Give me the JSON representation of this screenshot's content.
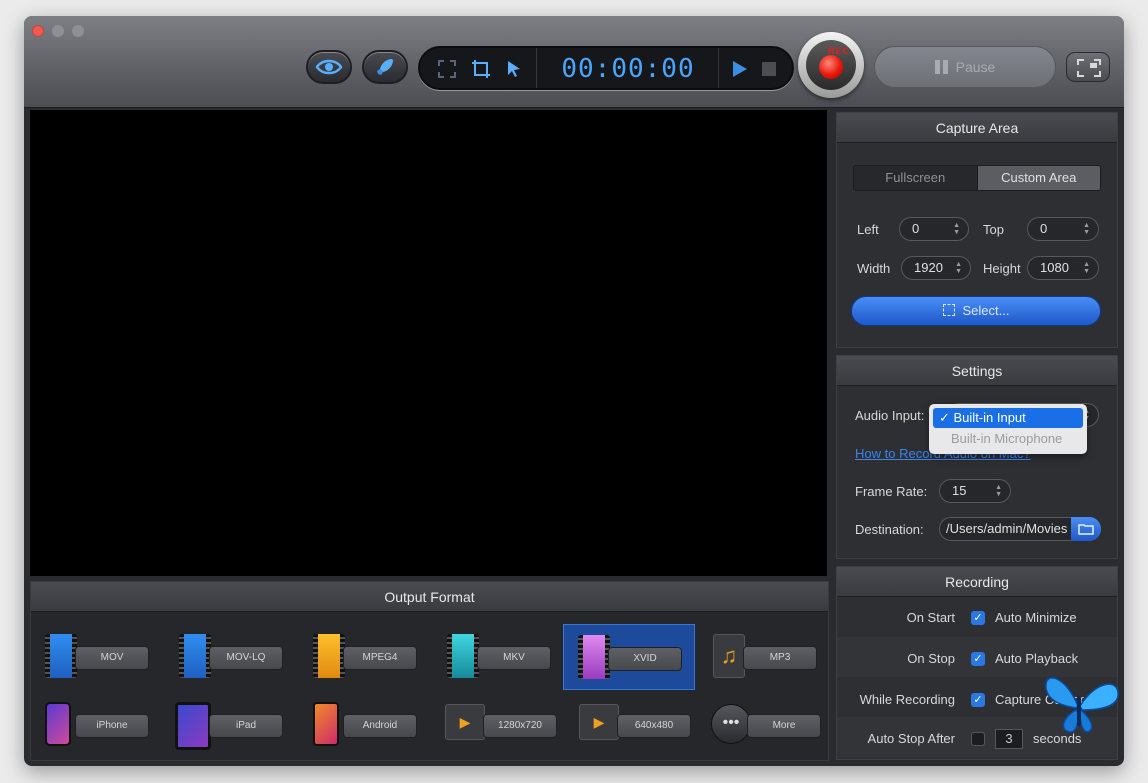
{
  "toolbar": {
    "timer": "00:00:00",
    "rec_label": "REC",
    "pause_label": "Pause"
  },
  "output_format": {
    "title": "Output Format",
    "formats": [
      {
        "label": "MOV",
        "icon": "film-blue-icon"
      },
      {
        "label": "MOV-LQ",
        "icon": "film-blue-icon"
      },
      {
        "label": "MPEG4",
        "icon": "film-orange-icon"
      },
      {
        "label": "MKV",
        "icon": "film-teal-icon"
      },
      {
        "label": "XVID",
        "icon": "film-purple-icon",
        "selected": true
      },
      {
        "label": "MP3",
        "icon": "music-note-icon"
      },
      {
        "label": "iPhone",
        "icon": "iphone-icon"
      },
      {
        "label": "iPad",
        "icon": "ipad-icon"
      },
      {
        "label": "Android",
        "icon": "android-phone-icon"
      },
      {
        "label": "1280x720",
        "icon": "video-player-icon"
      },
      {
        "label": "640x480",
        "icon": "video-player-icon"
      },
      {
        "label": "More",
        "icon": "ellipsis-icon"
      }
    ]
  },
  "capture_area": {
    "title": "Capture Area",
    "tab_fullscreen": "Fullscreen",
    "tab_custom": "Custom Area",
    "left_label": "Left",
    "left_value": "0",
    "top_label": "Top",
    "top_value": "0",
    "width_label": "Width",
    "width_value": "1920",
    "height_label": "Height",
    "height_value": "1080",
    "select_label": "Select..."
  },
  "settings": {
    "title": "Settings",
    "audio_label": "Audio Input:",
    "audio_selected": "Built-in Input",
    "audio_other": "Built-in Microphone",
    "howto_link": "How to Record Audio on Mac?",
    "framerate_label": "Frame Rate:",
    "framerate_value": "15",
    "destination_label": "Destination:",
    "destination_value": "/Users/admin/Movies"
  },
  "recording": {
    "title": "Recording",
    "on_start_label": "On Start",
    "on_start_option": "Auto Minimize",
    "on_stop_label": "On Stop",
    "on_stop_option": "Auto Playback",
    "while_label": "While Recording",
    "while_option": "Capture Cursor",
    "auto_stop_label": "Auto Stop After",
    "auto_stop_value": "3",
    "auto_stop_unit": "seconds"
  },
  "colors": {
    "accent": "#2a78e6",
    "timer": "#4aa5ff",
    "rec": "#e8170d",
    "selected_format": "#1d4a9a"
  }
}
